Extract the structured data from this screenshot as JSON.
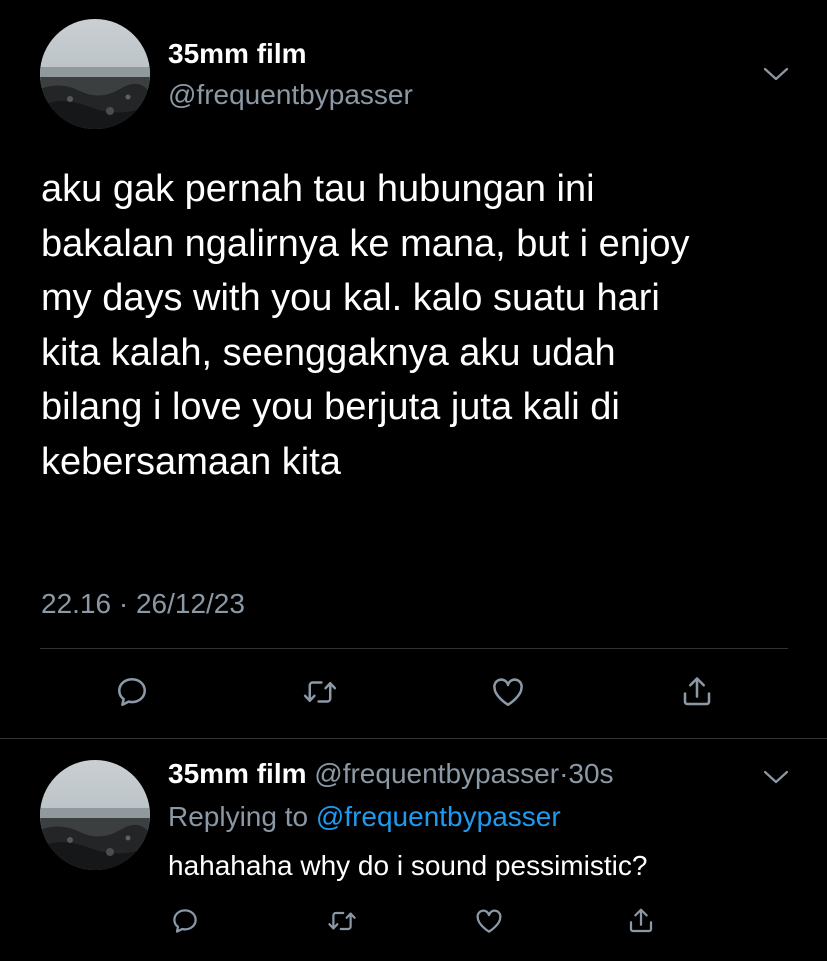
{
  "main_tweet": {
    "author_name": "35mm film",
    "author_handle": "@frequentbypasser",
    "lines": [
      "aku gak pernah tau hubungan ini",
      "bakalan ngalirnya ke mana, but i enjoy",
      "my days with you kal. kalo suatu hari",
      "kita kalah, seenggaknya aku udah",
      "bilang i love you berjuta juta kali di",
      "kebersamaan kita"
    ],
    "timestamp": "22.16 · 26/12/23",
    "icons": {
      "menu": "chevron-down-icon",
      "reply": "reply-icon",
      "retweet": "retweet-icon",
      "like": "heart-icon",
      "share": "share-icon"
    }
  },
  "reply_tweet": {
    "author_name": "35mm film",
    "author_handle": "@frequentbypasser",
    "separator": "·",
    "time_ago": "30s",
    "replying_label": "Replying to",
    "replying_to": "@frequentbypasser",
    "text": "hahahaha why do i sound pessimistic?"
  },
  "colors": {
    "background": "#000000",
    "text": "#ffffff",
    "secondary": "#8b98a5",
    "accent": "#1d9bf0",
    "divider": "#2f3336"
  }
}
